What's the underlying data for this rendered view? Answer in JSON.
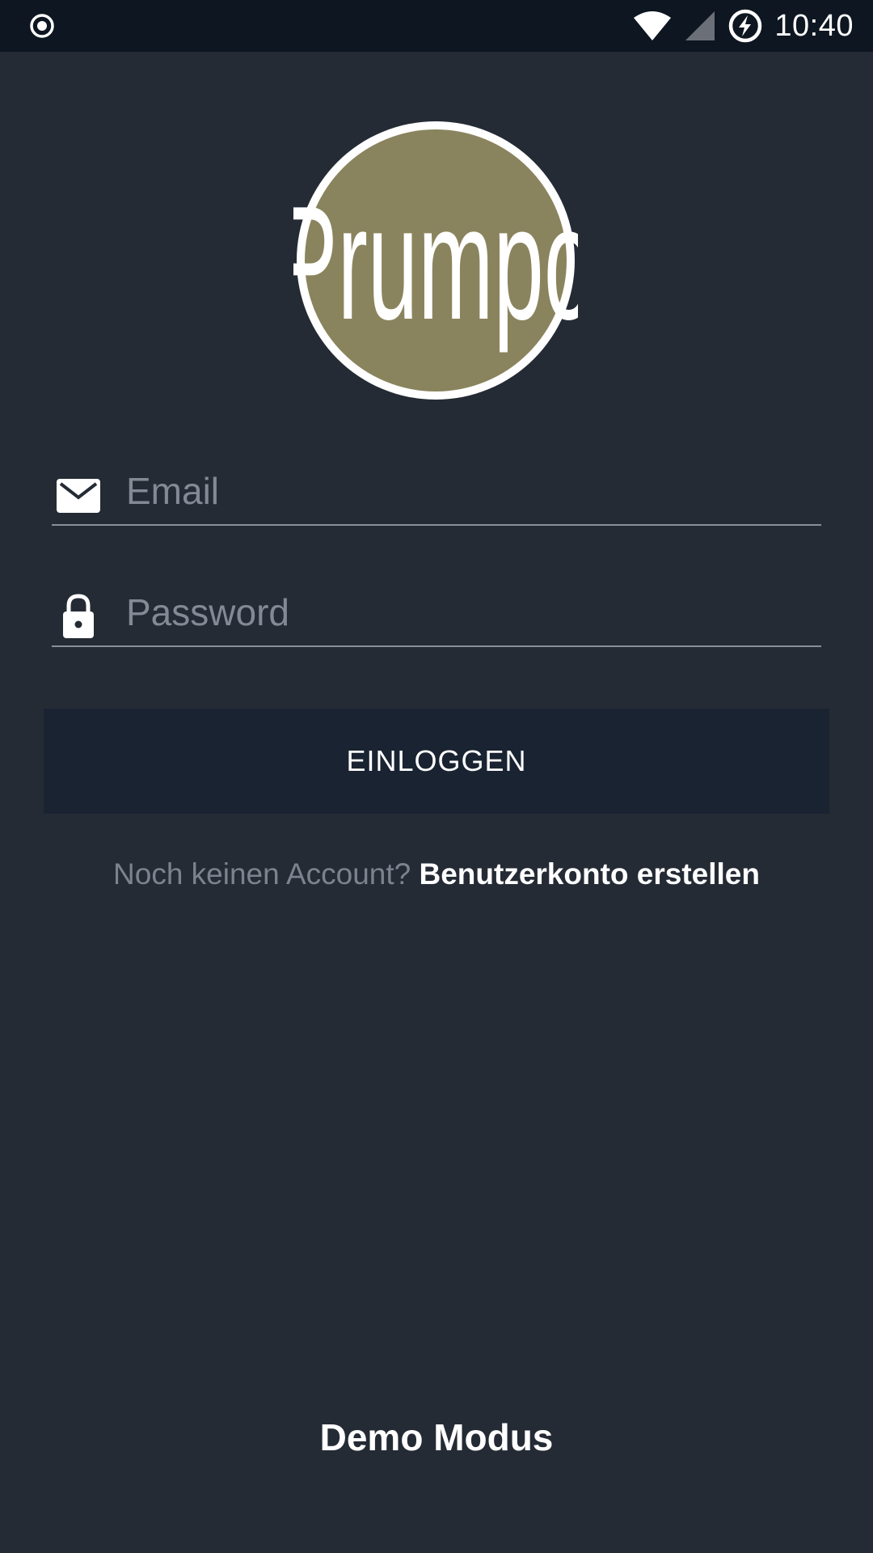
{
  "status_bar": {
    "time": "10:40",
    "icons": [
      "record-icon",
      "wifi-icon",
      "cell-signal-icon",
      "battery-charging-icon"
    ]
  },
  "logo": {
    "text": "Prumpo",
    "circle_color": "#8a845e",
    "ring_color": "#ffffff"
  },
  "form": {
    "email": {
      "placeholder": "Email",
      "value": "",
      "icon": "mail-icon"
    },
    "password": {
      "placeholder": "Password",
      "value": "",
      "icon": "lock-icon"
    },
    "login_label": "EINLOGGEN"
  },
  "signup": {
    "prompt": "Noch keinen Account?",
    "link": "Benutzerkonto erstellen"
  },
  "demo_label": "Demo Modus",
  "colors": {
    "background": "#252b35",
    "status_bar": "#0d1621",
    "button": "#1a2331",
    "muted_text": "#7d838e"
  }
}
